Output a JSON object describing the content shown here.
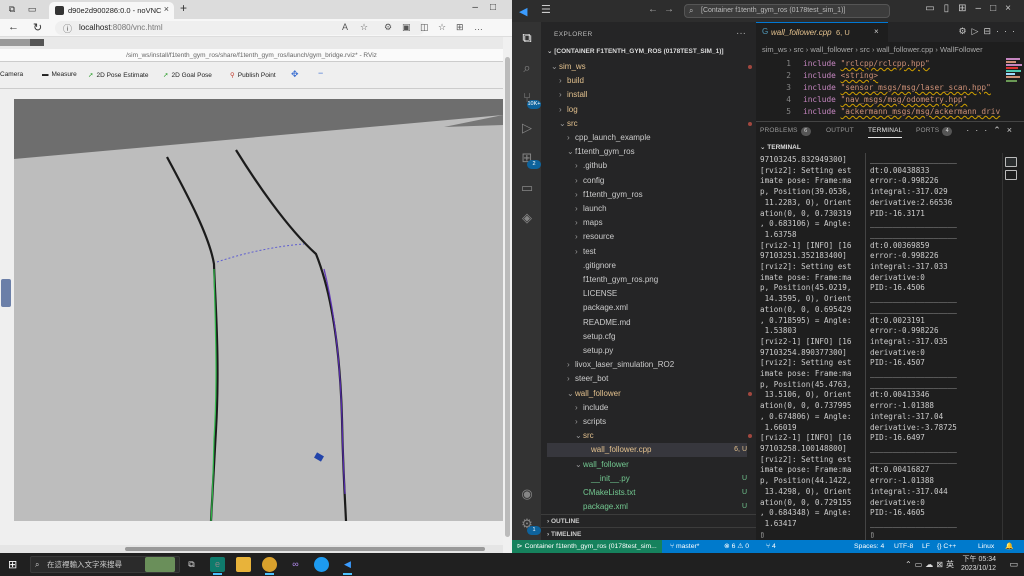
{
  "browser": {
    "tab_title": "d90e2d900286:0.0 - noVNC",
    "url_host": "localhost",
    "url_rest": ":8080/vnc.html"
  },
  "rviz": {
    "title": "/sim_ws/install/f1tenth_gym_ros/share/f1tenth_gym_ros/launch/gym_bridge.rviz* - RViz",
    "tools": [
      "Camera",
      "Measure",
      "2D Pose Estimate",
      "2D Goal Pose",
      "Publish Point"
    ]
  },
  "vscode": {
    "search": "[Container f1tenth_gym_ros (0178test_sim_1)]",
    "explorer_label": "EXPLORER",
    "root": "[CONTAINER F1TENTH_GYM_ROS (0178TEST_SIM_1)]",
    "badges": {
      "scm": "10K+",
      "ext": "2",
      "remote": "1"
    },
    "tree": [
      {
        "label": "sim_ws",
        "depth": 0,
        "chev": "⌄",
        "color": "#e2c08d"
      },
      {
        "label": "build",
        "depth": 1,
        "chev": "›",
        "color": "#e2c08d"
      },
      {
        "label": "install",
        "depth": 1,
        "chev": "›",
        "color": "#e2c08d"
      },
      {
        "label": "log",
        "depth": 1,
        "chev": "›",
        "color": "#e2c08d"
      },
      {
        "label": "src",
        "depth": 1,
        "chev": "⌄",
        "color": "#e2c08d"
      },
      {
        "label": "cpp_launch_example",
        "depth": 2,
        "chev": "›",
        "color": "#ccc"
      },
      {
        "label": "f1tenth_gym_ros",
        "depth": 2,
        "chev": "⌄",
        "color": "#ccc"
      },
      {
        "label": ".github",
        "depth": 3,
        "chev": "›",
        "color": "#ccc"
      },
      {
        "label": "config",
        "depth": 3,
        "chev": "›",
        "color": "#ccc"
      },
      {
        "label": "f1tenth_gym_ros",
        "depth": 3,
        "chev": "›",
        "color": "#ccc"
      },
      {
        "label": "launch",
        "depth": 3,
        "chev": "›",
        "color": "#ccc"
      },
      {
        "label": "maps",
        "depth": 3,
        "chev": "›",
        "color": "#ccc"
      },
      {
        "label": "resource",
        "depth": 3,
        "chev": "›",
        "color": "#ccc"
      },
      {
        "label": "test",
        "depth": 3,
        "chev": "›",
        "color": "#ccc"
      },
      {
        "label": ".gitignore",
        "depth": 3,
        "chev": "",
        "color": "#ccc"
      },
      {
        "label": "f1tenth_gym_ros.png",
        "depth": 3,
        "chev": "",
        "color": "#ccc"
      },
      {
        "label": "LICENSE",
        "depth": 3,
        "chev": "",
        "color": "#ccc"
      },
      {
        "label": "package.xml",
        "depth": 3,
        "chev": "",
        "color": "#ccc"
      },
      {
        "label": "README.md",
        "depth": 3,
        "chev": "",
        "color": "#ccc"
      },
      {
        "label": "setup.cfg",
        "depth": 3,
        "chev": "",
        "color": "#ccc"
      },
      {
        "label": "setup.py",
        "depth": 3,
        "chev": "",
        "color": "#ccc"
      },
      {
        "label": "livox_laser_simulation_RO2",
        "depth": 2,
        "chev": "›",
        "color": "#ccc"
      },
      {
        "label": "steer_bot",
        "depth": 2,
        "chev": "›",
        "color": "#ccc"
      },
      {
        "label": "wall_follower",
        "depth": 2,
        "chev": "⌄",
        "color": "#e2c08d"
      },
      {
        "label": "include",
        "depth": 3,
        "chev": "›",
        "color": "#ccc"
      },
      {
        "label": "scripts",
        "depth": 3,
        "chev": "›",
        "color": "#ccc"
      },
      {
        "label": "src",
        "depth": 3,
        "chev": "⌄",
        "color": "#e2c08d"
      },
      {
        "label": "wall_follower.cpp",
        "depth": 4,
        "chev": "",
        "color": "#e2c08d",
        "mark": "6, U",
        "selected": true
      },
      {
        "label": "wall_follower",
        "depth": 3,
        "chev": "⌄",
        "color": "#73c991"
      },
      {
        "label": "__init__.py",
        "depth": 4,
        "chev": "",
        "color": "#73c991",
        "mark": "U"
      },
      {
        "label": "CMakeLists.txt",
        "depth": 3,
        "chev": "",
        "color": "#73c991",
        "mark": "U"
      },
      {
        "label": "package.xml",
        "depth": 3,
        "chev": "",
        "color": "#73c991",
        "mark": "U"
      }
    ],
    "outline": "OUTLINE",
    "timeline": "TIMELINE",
    "editor_tab": "wall_follower.cpp",
    "editor_tab_mark": "6, U",
    "breadcrumbs": "sim_ws › src › wall_follower › src › wall_follower.cpp › WallFollower",
    "code": [
      {
        "n": "1",
        "t": "\"rclcpp/rclcpp.hpp\""
      },
      {
        "n": "2",
        "t": "<string>"
      },
      {
        "n": "3",
        "t": "\"sensor_msgs/msg/laser_scan.hpp\""
      },
      {
        "n": "4",
        "t": "\"nav_msgs/msg/odometry.hpp\""
      },
      {
        "n": "5",
        "t": "\"ackermann_msgs/msg/ackermann_driv"
      }
    ],
    "code_kw": "include",
    "panel_tabs": [
      "PROBLEMS",
      "OUTPUT",
      "TERMINAL",
      "PORTS"
    ],
    "panel_badges": {
      "problems": "6",
      "ports": "4"
    },
    "terminal_label": "TERMINAL",
    "term_left": "97103245.832949300]\n[rviz2]: Setting est\nimate pose: Frame:ma\np, Position(39.0536,\n 11.2283, 0), Orient\nation(0, 0, 0.730319\n, 0.683106) = Angle:\n 1.63758\n[rviz2-1] [INFO] [16\n97103251.352183400]\n[rviz2]: Setting est\nimate pose: Frame:ma\np, Position(45.0219,\n 14.3595, 0), Orient\nation(0, 0, 0.695429\n, 0.718595) = Angle:\n 1.53803\n[rviz2-1] [INFO] [16\n97103254.890377300]\n[rviz2]: Setting est\nimate pose: Frame:ma\np, Position(45.4763,\n 13.5106, 0), Orient\nation(0, 0, 0.737995\n, 0.674806) = Angle:\n 1.66019\n[rviz2-1] [INFO] [16\n97103258.100148800]\n[rviz2]: Setting est\nimate pose: Frame:ma\np, Position(44.1422,\n 13.4298, 0), Orient\nation(0, 0, 0.729155\n, 0.684348) = Angle:\n 1.63417\n▯",
    "term_right": "___________________\ndt:0.00438833\nerror:-0.998226\nintegral:-317.029\nderivative:2.66536\nPID:-16.3171\n___________________\n___________________\ndt:0.00369859\nerror:-0.998226\nintegral:-317.033\nderivative:0\nPID:-16.4506\n___________________\n___________________\ndt:0.0023191\nerror:-0.998226\nintegral:-317.035\nderivative:0\nPID:-16.4507\n___________________\n___________________\ndt:0.00413346\nerror:-1.01388\nintegral:-317.04\nderivative:-3.78725\nPID:-16.6497\n___________________\n___________________\ndt:0.00416827\nerror:-1.01388\nintegral:-317.044\nderivative:0\nPID:-16.4605\n___________________\n▯",
    "status": {
      "remote": "Container f1tenth_gym_ros (0178test_sim...",
      "branch": "master*",
      "problems": "⊗ 6 ⚠ 0",
      "ports": "⑂ 4",
      "spaces": "Spaces: 4",
      "encoding": "UTF-8",
      "eol": "LF",
      "lang": "{} C++",
      "os": "Linux"
    }
  },
  "taskbar": {
    "search_placeholder": "在這裡輸入文字來搜尋",
    "ime": "英",
    "time": "下午 05:34",
    "date": "2023/10/12"
  }
}
